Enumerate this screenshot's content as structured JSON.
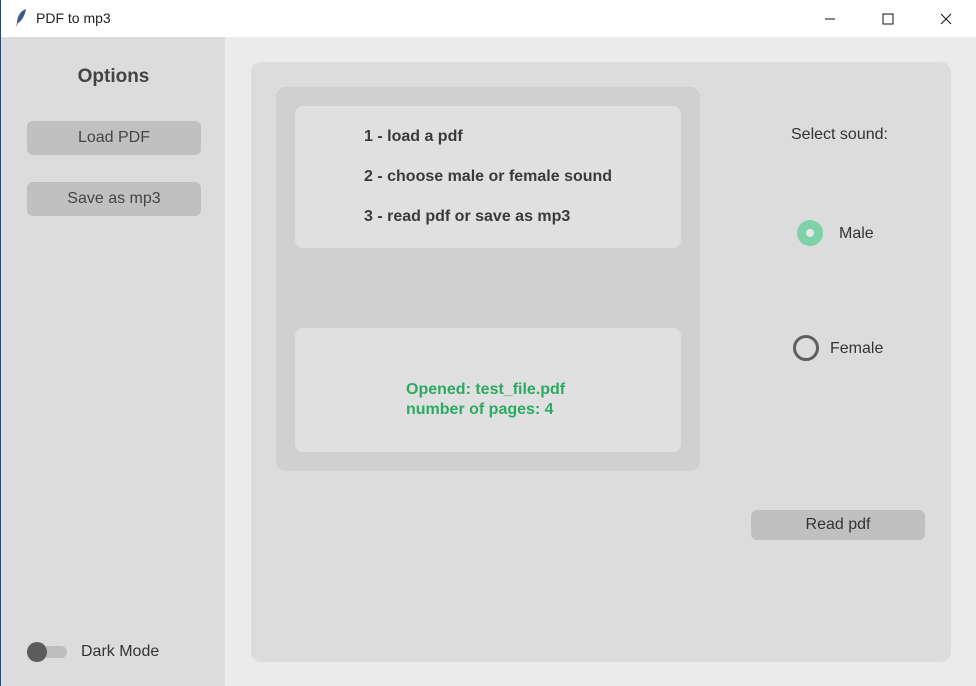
{
  "window": {
    "title": "PDF to mp3",
    "icon": "feather-icon"
  },
  "sidebar": {
    "title": "Options",
    "load_label": "Load PDF",
    "save_label": "Save as mp3",
    "dark_mode_label": "Dark Mode",
    "dark_mode_on": false
  },
  "instructions": [
    "1 - load a pdf",
    "2 - choose male or female sound",
    "3 - read pdf or save as mp3"
  ],
  "status": {
    "opened": "Opened:  test_file.pdf",
    "pages": "number of pages:  4"
  },
  "sound": {
    "label": "Select sound:",
    "options": [
      "Male",
      "Female"
    ],
    "selected": "Male"
  },
  "read_label": "Read pdf",
  "colors": {
    "accent": "#7ed2a7",
    "status_text": "#2bab62",
    "button": "#c0c0c0"
  }
}
